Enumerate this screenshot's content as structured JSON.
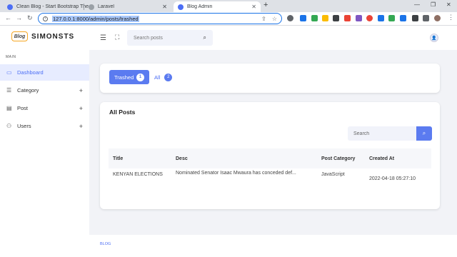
{
  "browser": {
    "tabs": [
      {
        "title": "Clean Blog - Start Bootstrap The",
        "favicon_color": "#4c6ef5"
      },
      {
        "title": "Laravel",
        "favicon_color": "#777777"
      },
      {
        "title": "Blog Admin",
        "favicon_color": "#4c6ef5"
      }
    ],
    "new_tab": "+",
    "url": "127.0.0.1:8000/admin/posts/trashed"
  },
  "header": {
    "logo_badge": "Blog",
    "brand": "SIMONSTS",
    "search_placeholder": "Search posts",
    "avatar": "👤"
  },
  "sidebar": {
    "section": "MAIN",
    "items": [
      {
        "label": "Dashboard",
        "icon": "dashboard-icon",
        "glyph": "▭",
        "active": true,
        "plus": ""
      },
      {
        "label": "Category",
        "icon": "list-icon",
        "glyph": "☰",
        "active": false,
        "plus": "+"
      },
      {
        "label": "Post",
        "icon": "document-icon",
        "glyph": "▤",
        "active": false,
        "plus": "+"
      },
      {
        "label": "Users",
        "icon": "users-icon",
        "glyph": "⚇",
        "active": false,
        "plus": "+"
      }
    ]
  },
  "tabs": {
    "trashed_label": "Trashed",
    "trashed_count": "1",
    "all_label": "All",
    "all_count": "2"
  },
  "posts": {
    "title": "All Posts",
    "search_placeholder": "Search",
    "columns": [
      "Title",
      "Desc",
      "Post Category",
      "Created At"
    ],
    "rows": [
      {
        "title": "KENYAN ELECTIONS",
        "desc": "Nominated Senator Isaac Mwaura has conceded def...",
        "category": "JavaScript",
        "created_at": "2022-04-18 05:27:10"
      }
    ]
  },
  "footer": {
    "text": "BLOG"
  },
  "colors": {
    "accent": "#5b7bf0",
    "background": "#f2f3f7"
  }
}
